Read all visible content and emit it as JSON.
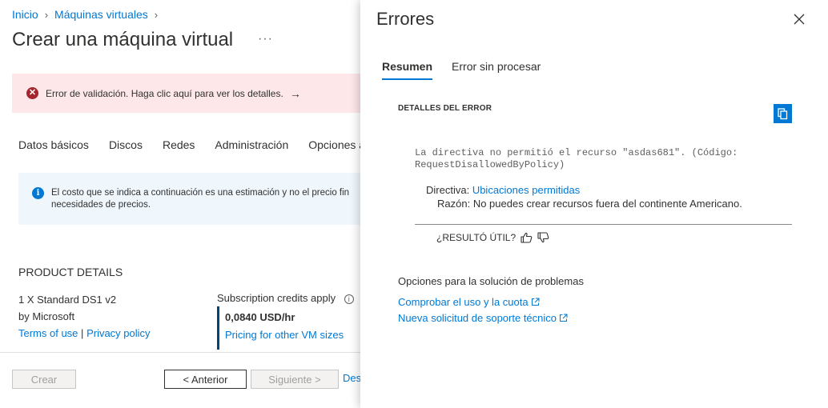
{
  "breadcrumb": {
    "home": "Inicio",
    "vms": "Máquinas virtuales"
  },
  "page": {
    "title": "Crear una máquina virtual",
    "more": "···"
  },
  "validation": {
    "text": "Error de validación. Haga clic aquí para ver los detalles.",
    "arrow": "→",
    "color": "#fde7e9"
  },
  "tabs": [
    "Datos básicos",
    "Discos",
    "Redes",
    "Administración",
    "Opciones a"
  ],
  "info": {
    "line1": "El costo que se indica a continuación es una estimación y no el precio fin",
    "line2": "necesidades de precios."
  },
  "product": {
    "title": "PRODUCT DETAILS",
    "name": "1 X Standard DS1 v2",
    "vendor": "by Microsoft",
    "terms": "Terms of use",
    "separator": "|",
    "privacy": "Privacy policy",
    "credits": "Subscription credits apply",
    "price": "0,0840 USD/hr",
    "pricing_link": "Pricing for other VM sizes"
  },
  "footer": {
    "create": "Crear",
    "previous": "< Anterior",
    "next": "Siguiente >",
    "download": "Des"
  },
  "panel": {
    "title": "Errores",
    "tabs": [
      "Resumen",
      "Error sin procesar"
    ],
    "active_tab": "Resumen",
    "section_title": "DETALLES DEL ERROR",
    "message_line1": "La directiva no permitió el recurso \"asdas681\". (Código:",
    "message_line2": "RequestDisallowedByPolicy)",
    "policy_label": "Directiva:",
    "policy_link": "Ubicaciones permitidas",
    "reason_label": "Razón:",
    "reason_text": "No puedes crear recursos fuera del continente Americano.",
    "helpful": "¿RESULTÓ ÚTIL?",
    "troubleshoot_title": "Opciones para la solución de problemas",
    "link_quota": "Comprobar el uso y la cuota",
    "link_support": "Nueva solicitud de soporte técnico"
  },
  "colors": {
    "accent": "#0078d4",
    "error": "#a4262c",
    "info_bg": "#eff6fc"
  }
}
